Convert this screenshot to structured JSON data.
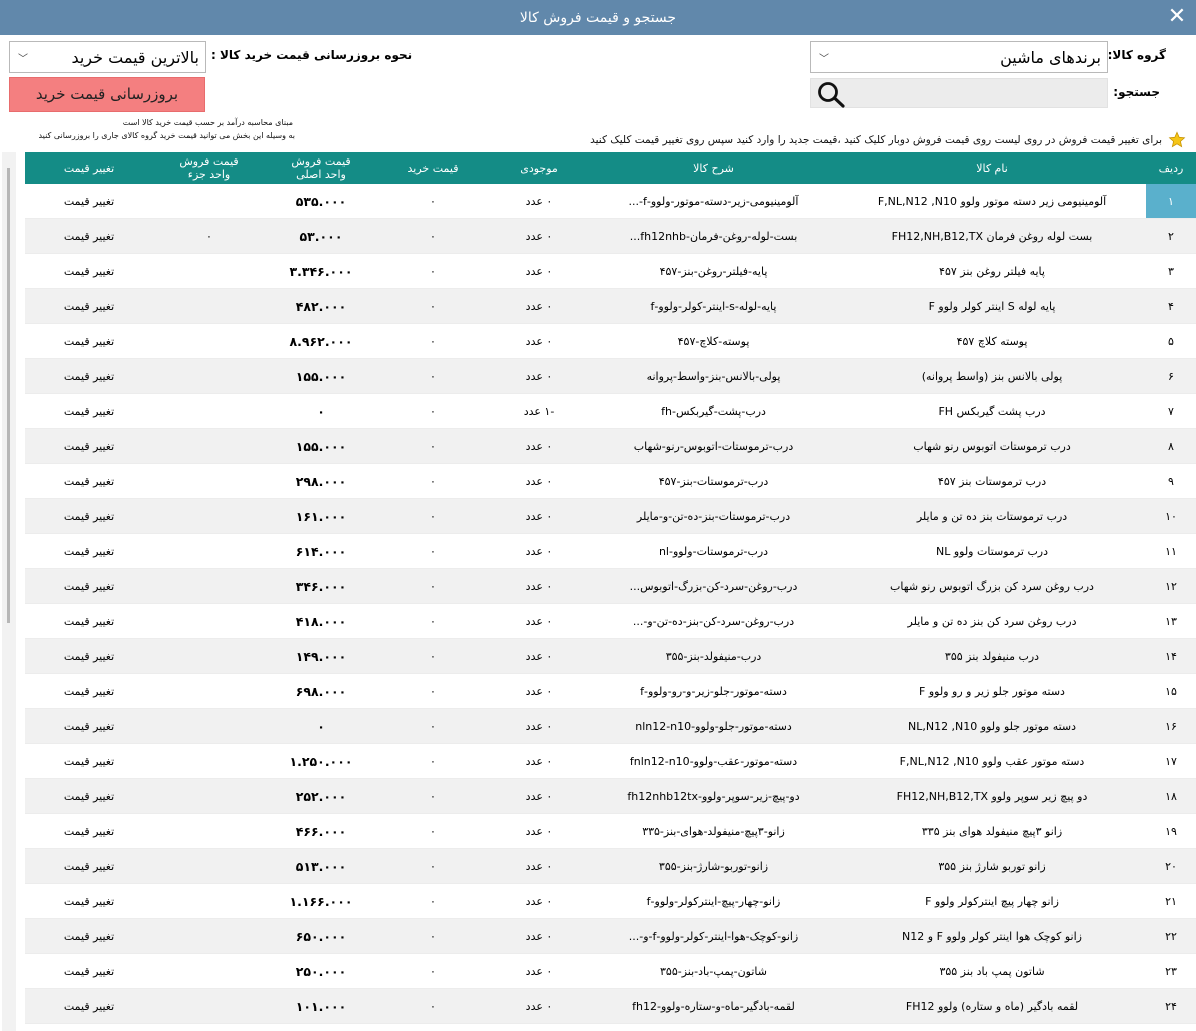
{
  "window": {
    "title": "جستجو و قیمت فروش کالا",
    "close_glyph": "✕"
  },
  "filters": {
    "group_label": "گروه کالا:",
    "group_value": "برندهای ماشین",
    "search_label": "جستجو:",
    "search_value": "",
    "method_label": "نحوه بروزرسانی قیمت خرید کالا :",
    "method_value": "بالاترین قیمت خرید",
    "update_button": "بروزرسانی قیمت خرید",
    "note_line1": "مبنای محاسبه درآمد بر حسب قیمت خرید کالا است",
    "note_line2": "به وسیله این بخش می توانید قیمت خرید گروه کالای جاری را بروزرسانی کنید"
  },
  "hint": "برای تغییر قیمت فروش در روی لیست روی قیمت فروش دوبار کلیک کنید ،قیمت جدید را وارد کنید سپس روی تغییر قیمت کلیک کنید",
  "colors": {
    "titlebar": "#6188ab",
    "header": "#148c86",
    "button": "#f47f80",
    "selected_index": "#5ab0cc"
  },
  "table": {
    "headers": {
      "idx": "ردیف",
      "name": "نام کالا",
      "desc": "شرح کالا",
      "stock": "موجودی",
      "buy": "قیمت خرید",
      "sale_line1": "قیمت فروش",
      "sale_line2": "واحد اصلی",
      "part_line1": "قیمت فروش",
      "part_line2": "واحد جزء",
      "change": "تغییر قیمت"
    },
    "rows": [
      {
        "idx": "۱",
        "name": "آلومینیومی زیر دسته موتور ولوو F,NL,N12 ,N10",
        "desc": "آلومینیومی-زیر-دسته-موتور-ولوو-f-...",
        "stock": "۰ عدد",
        "buy": "۰",
        "sale": "۵۳۵.۰۰۰",
        "part": "",
        "change": "تغییر قیمت"
      },
      {
        "idx": "۲",
        "name": "بست لوله روغن فرمان FH12,NH,B12,TX",
        "desc": "بست-لوله-روغن-فرمان-fh12nhb...",
        "stock": "۰ عدد",
        "buy": "۰",
        "sale": "۵۳.۰۰۰",
        "part": "۰",
        "change": "تغییر قیمت"
      },
      {
        "idx": "۳",
        "name": "پایه فیلتر روغن بنز ۴۵۷",
        "desc": "پایه-فیلتر-روغن-بنز-۴۵۷",
        "stock": "۰ عدد",
        "buy": "۰",
        "sale": "۳.۳۴۶.۰۰۰",
        "part": "",
        "change": "تغییر قیمت"
      },
      {
        "idx": "۴",
        "name": "پایه لوله S اینتر کولر ولوو F",
        "desc": "پایه-لوله-s-اینتر-کولر-ولوو-f",
        "stock": "۰ عدد",
        "buy": "۰",
        "sale": "۴۸۲.۰۰۰",
        "part": "",
        "change": "تغییر قیمت"
      },
      {
        "idx": "۵",
        "name": "پوسته کلاچ ۴۵۷",
        "desc": "پوسته-کلاچ-۴۵۷",
        "stock": "۰ عدد",
        "buy": "۰",
        "sale": "۸.۹۶۲.۰۰۰",
        "part": "",
        "change": "تغییر قیمت"
      },
      {
        "idx": "۶",
        "name": "پولی بالانس بنز (واسط پروانه)",
        "desc": "پولی-بالانس-بنز-واسط-پروانه",
        "stock": "۰ عدد",
        "buy": "۰",
        "sale": "۱۵۵.۰۰۰",
        "part": "",
        "change": "تغییر قیمت"
      },
      {
        "idx": "۷",
        "name": "درب پشت گیربکس FH",
        "desc": "درب-پشت-گیربکس-fh",
        "stock": "-۱ عدد",
        "buy": "۰",
        "sale": "۰",
        "part": "",
        "change": "تغییر قیمت"
      },
      {
        "idx": "۸",
        "name": "درب ترموستات اتوبوس رنو شهاب",
        "desc": "درب-ترموستات-اتوبوس-رنو-شهاب",
        "stock": "۰ عدد",
        "buy": "۰",
        "sale": "۱۵۵.۰۰۰",
        "part": "",
        "change": "تغییر قیمت"
      },
      {
        "idx": "۹",
        "name": "درب ترموستات بنز ۴۵۷",
        "desc": "درب-ترموستات-بنز-۴۵۷",
        "stock": "۰ عدد",
        "buy": "۰",
        "sale": "۲۹۸.۰۰۰",
        "part": "",
        "change": "تغییر قیمت"
      },
      {
        "idx": "۱۰",
        "name": "درب ترموستات بنز ده تن و مایلر",
        "desc": "درب-ترموستات-بنز-ده-تن-و-مایلر",
        "stock": "۰ عدد",
        "buy": "۰",
        "sale": "۱۶۱.۰۰۰",
        "part": "",
        "change": "تغییر قیمت"
      },
      {
        "idx": "۱۱",
        "name": "درب ترموستات ولوو NL",
        "desc": "درب-ترموستات-ولوو-nl",
        "stock": "۰ عدد",
        "buy": "۰",
        "sale": "۶۱۴.۰۰۰",
        "part": "",
        "change": "تغییر قیمت"
      },
      {
        "idx": "۱۲",
        "name": "درب روغن سرد کن بزرگ اتوبوس رنو شهاب",
        "desc": "درب-روغن-سرد-کن-بزرگ-اتوبوس...",
        "stock": "۰ عدد",
        "buy": "۰",
        "sale": "۳۴۶.۰۰۰",
        "part": "",
        "change": "تغییر قیمت"
      },
      {
        "idx": "۱۳",
        "name": "درب روغن سرد کن بنز ده تن و مایلر",
        "desc": "درب-روغن-سرد-کن-بنز-ده-تن-و-...",
        "stock": "۰ عدد",
        "buy": "۰",
        "sale": "۴۱۸.۰۰۰",
        "part": "",
        "change": "تغییر قیمت"
      },
      {
        "idx": "۱۴",
        "name": "درب منیفولد بنز ۳۵۵",
        "desc": "درب-منیفولد-بنز-۳۵۵",
        "stock": "۰ عدد",
        "buy": "۰",
        "sale": "۱۴۹.۰۰۰",
        "part": "",
        "change": "تغییر قیمت"
      },
      {
        "idx": "۱۵",
        "name": "دسته موتور جلو زیر و رو ولوو F",
        "desc": "دسته-موتور-جلو-زیر-و-رو-ولوو-f",
        "stock": "۰ عدد",
        "buy": "۰",
        "sale": "۶۹۸.۰۰۰",
        "part": "",
        "change": "تغییر قیمت"
      },
      {
        "idx": "۱۶",
        "name": "دسته موتور جلو ولوو NL,N12 ,N10",
        "desc": "دسته-موتور-جلو-ولوو-nln12-n10",
        "stock": "۰ عدد",
        "buy": "۰",
        "sale": "۰",
        "part": "",
        "change": "تغییر قیمت"
      },
      {
        "idx": "۱۷",
        "name": "دسته موتور عقب ولوو F,NL,N12 ,N10",
        "desc": "دسته-موتور-عقب-ولوو-fnln12-n10",
        "stock": "۰ عدد",
        "buy": "۰",
        "sale": "۱.۲۵۰.۰۰۰",
        "part": "",
        "change": "تغییر قیمت"
      },
      {
        "idx": "۱۸",
        "name": "دو پیچ زیر سوپر ولوو FH12,NH,B12,TX",
        "desc": "دو-پیچ-زیر-سوپر-ولوو-fh12nhb12tx",
        "stock": "۰ عدد",
        "buy": "۰",
        "sale": "۲۵۲.۰۰۰",
        "part": "",
        "change": "تغییر قیمت"
      },
      {
        "idx": "۱۹",
        "name": "زانو ۳پیچ منیفولد هوای بنز ۳۳۵",
        "desc": "زانو-۳پیچ-منیفولد-هوای-بنز-۳۳۵",
        "stock": "۰ عدد",
        "buy": "۰",
        "sale": "۴۶۶.۰۰۰",
        "part": "",
        "change": "تغییر قیمت"
      },
      {
        "idx": "۲۰",
        "name": "زانو توربو شارژ بنز ۳۵۵",
        "desc": "زانو-توربو-شارژ-بنز-۳۵۵",
        "stock": "۰ عدد",
        "buy": "۰",
        "sale": "۵۱۳.۰۰۰",
        "part": "",
        "change": "تغییر قیمت"
      },
      {
        "idx": "۲۱",
        "name": "زانو چهار پیچ  اینترکولر ولوو F",
        "desc": "زانو-چهار-پیچ-اینترکولر-ولوو-f",
        "stock": "۰ عدد",
        "buy": "۰",
        "sale": "۱.۱۶۶.۰۰۰",
        "part": "",
        "change": "تغییر قیمت"
      },
      {
        "idx": "۲۲",
        "name": "زانو کوچک هوا اینتر کولر ولوو F و N12",
        "desc": "زانو-کوچک-هوا-اینتر-کولر-ولوو-f-و-...",
        "stock": "۰ عدد",
        "buy": "۰",
        "sale": "۶۵۰.۰۰۰",
        "part": "",
        "change": "تغییر قیمت"
      },
      {
        "idx": "۲۳",
        "name": "شاتون پمپ باد بنز ۳۵۵",
        "desc": "شاتون-پمپ-باد-بنز-۳۵۵",
        "stock": "۰ عدد",
        "buy": "۰",
        "sale": "۲۵۰.۰۰۰",
        "part": "",
        "change": "تغییر قیمت"
      },
      {
        "idx": "۲۴",
        "name": "لقمه بادگیر (ماه و ستاره) ولوو FH12",
        "desc": "لقمه-بادگیر-ماه-و-ستاره-ولوو-fh12",
        "stock": "۰ عدد",
        "buy": "۰",
        "sale": "۱۰۱.۰۰۰",
        "part": "",
        "change": "تغییر قیمت"
      }
    ]
  }
}
